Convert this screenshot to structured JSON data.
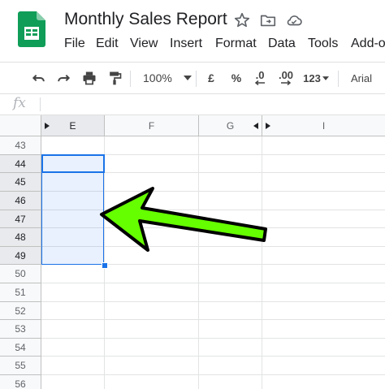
{
  "document": {
    "title": "Monthly Sales Report",
    "icons": [
      "star-icon",
      "move-to-folder-icon",
      "cloud-status-icon"
    ]
  },
  "menu": [
    "File",
    "Edit",
    "View",
    "Insert",
    "Format",
    "Data",
    "Tools",
    "Add-o"
  ],
  "toolbar": {
    "zoom": "100%",
    "currency": "£",
    "percent": "%",
    "decrease_decimal": ".0",
    "increase_decimal": ".00",
    "number_format": "123",
    "font": "Arial"
  },
  "formula_bar": {
    "fx_label": "fx",
    "value": ""
  },
  "columns": [
    "E",
    "F",
    "G",
    "I"
  ],
  "rows": [
    "43",
    "44",
    "45",
    "46",
    "47",
    "48",
    "49",
    "50",
    "51",
    "52",
    "53",
    "54",
    "55",
    "56"
  ],
  "selection": {
    "range": "E44:E49"
  },
  "colors": {
    "selection": "#1a73e8",
    "arrow_fill": "#66ff00",
    "sheets_green": "#0f9d58"
  }
}
